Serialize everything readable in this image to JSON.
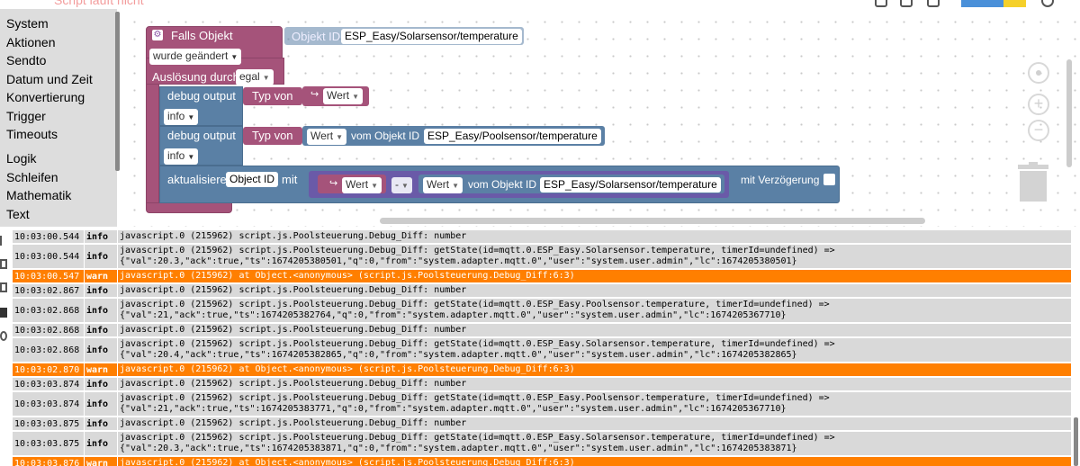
{
  "topbar": {
    "status": "Script läuft nicht"
  },
  "toolbox": [
    "System",
    "Aktionen",
    "Sendto",
    "Datum und Zeit",
    "Konvertierung",
    "Trigger",
    "Timeouts",
    "Logik",
    "Schleifen",
    "Mathematik",
    "Text"
  ],
  "blocks": {
    "trigger": {
      "label": "Falls Objekt",
      "mode": "wurde geändert",
      "ausloesung": "Auslösung durch",
      "ausloesung_value": "egal",
      "objid_label": "Objekt ID",
      "objid": "ESP_Easy/Solarsensor/temperature"
    },
    "debug1": {
      "label": "debug output",
      "level": "info",
      "typeof": "Typ von",
      "var": "Wert"
    },
    "debug2": {
      "label": "debug output",
      "level": "info",
      "typeof": "Typ von",
      "attr": "Wert",
      "from_label": "vom Objekt ID",
      "objid": "ESP_Easy/Poolsensor/temperature"
    },
    "update": {
      "label": "aktualisiere",
      "objid": "Object ID",
      "with_label": "mit",
      "var": "Wert",
      "op": "-",
      "attr": "Wert",
      "from_label": "vom Objekt ID",
      "objid2": "ESP_Easy/Solarsensor/temperature",
      "delay_label": "mit Verzögerung"
    }
  },
  "colors": {
    "warn": "#ff7f00",
    "event_block": "#a5537a",
    "action_block": "#5a80a5",
    "math_block": "#6a5aa8"
  },
  "log": [
    {
      "time": "10:03:00.544",
      "sev": "info",
      "msg": "javascript.0 (215962) script.js.Poolsteuerung.Debug_Diff: number"
    },
    {
      "time": "10:03:00.544",
      "sev": "info",
      "msg": "javascript.0 (215962) script.js.Poolsteuerung.Debug_Diff: getState(id=mqtt.0.ESP_Easy.Solarsensor.temperature, timerId=undefined) =>\n{\"val\":20.3,\"ack\":true,\"ts\":1674205380501,\"q\":0,\"from\":\"system.adapter.mqtt.0\",\"user\":\"system.user.admin\",\"lc\":1674205380501}"
    },
    {
      "time": "10:03:00.547",
      "sev": "warn",
      "msg": "javascript.0 (215962) at Object.<anonymous> (script.js.Poolsteuerung.Debug_Diff:6:3)"
    },
    {
      "time": "10:03:02.867",
      "sev": "info",
      "msg": "javascript.0 (215962) script.js.Poolsteuerung.Debug_Diff: number"
    },
    {
      "time": "10:03:02.868",
      "sev": "info",
      "msg": "javascript.0 (215962) script.js.Poolsteuerung.Debug_Diff: getState(id=mqtt.0.ESP_Easy.Poolsensor.temperature, timerId=undefined) =>\n{\"val\":21,\"ack\":true,\"ts\":1674205382764,\"q\":0,\"from\":\"system.adapter.mqtt.0\",\"user\":\"system.user.admin\",\"lc\":1674205367710}"
    },
    {
      "time": "10:03:02.868",
      "sev": "info",
      "msg": "javascript.0 (215962) script.js.Poolsteuerung.Debug_Diff: number"
    },
    {
      "time": "10:03:02.868",
      "sev": "info",
      "msg": "javascript.0 (215962) script.js.Poolsteuerung.Debug_Diff: getState(id=mqtt.0.ESP_Easy.Solarsensor.temperature, timerId=undefined) =>\n{\"val\":20.4,\"ack\":true,\"ts\":1674205382865,\"q\":0,\"from\":\"system.adapter.mqtt.0\",\"user\":\"system.user.admin\",\"lc\":1674205382865}"
    },
    {
      "time": "10:03:02.870",
      "sev": "warn",
      "msg": "javascript.0 (215962) at Object.<anonymous> (script.js.Poolsteuerung.Debug_Diff:6:3)"
    },
    {
      "time": "10:03:03.874",
      "sev": "info",
      "msg": "javascript.0 (215962) script.js.Poolsteuerung.Debug_Diff: number"
    },
    {
      "time": "10:03:03.874",
      "sev": "info",
      "msg": "javascript.0 (215962) script.js.Poolsteuerung.Debug_Diff: getState(id=mqtt.0.ESP_Easy.Poolsensor.temperature, timerId=undefined) =>\n{\"val\":21,\"ack\":true,\"ts\":1674205383771,\"q\":0,\"from\":\"system.adapter.mqtt.0\",\"user\":\"system.user.admin\",\"lc\":1674205367710}"
    },
    {
      "time": "10:03:03.875",
      "sev": "info",
      "msg": "javascript.0 (215962) script.js.Poolsteuerung.Debug_Diff: number"
    },
    {
      "time": "10:03:03.875",
      "sev": "info",
      "msg": "javascript.0 (215962) script.js.Poolsteuerung.Debug_Diff: getState(id=mqtt.0.ESP_Easy.Solarsensor.temperature, timerId=undefined) =>\n{\"val\":20.3,\"ack\":true,\"ts\":1674205383871,\"q\":0,\"from\":\"system.adapter.mqtt.0\",\"user\":\"system.user.admin\",\"lc\":1674205383871}"
    },
    {
      "time": "10:03:03.876",
      "sev": "warn",
      "msg": "javascript.0 (215962) at Object.<anonymous> (script.js.Poolsteuerung.Debug_Diff:6:3)"
    }
  ]
}
